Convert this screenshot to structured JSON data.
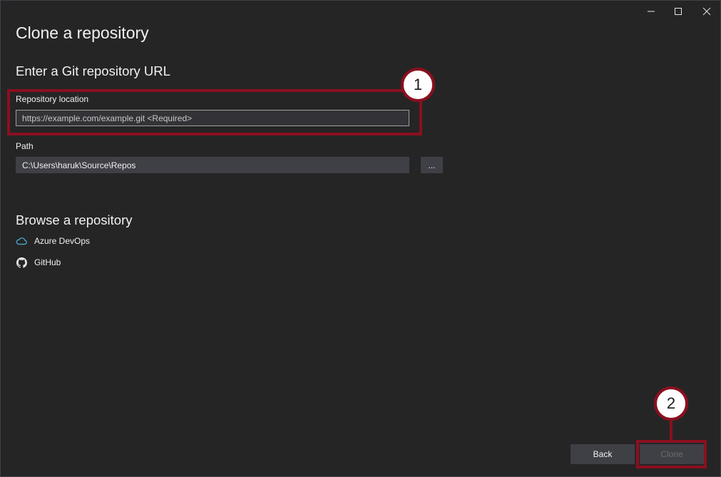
{
  "window": {
    "title": "Clone a repository"
  },
  "url_section": {
    "heading": "Enter a Git repository URL",
    "repo_label": "Repository location",
    "repo_placeholder": "https://example.com/example.git <Required>",
    "repo_value": "",
    "path_label": "Path",
    "path_value": "C:\\Users\\haruk\\Source\\Repos",
    "browse_button_label": "..."
  },
  "browse_section": {
    "heading": "Browse a repository",
    "items": [
      {
        "label": "Azure DevOps",
        "icon": "cloud-icon"
      },
      {
        "label": "GitHub",
        "icon": "github-icon"
      }
    ]
  },
  "footer": {
    "back_label": "Back",
    "clone_label": "Clone",
    "clone_enabled": false
  },
  "annotations": {
    "callout_1": "1",
    "callout_2": "2",
    "color": "#8b0f1f"
  },
  "colors": {
    "background": "#252526",
    "control": "#3f3f46",
    "azure_icon": "#4fb3d9"
  }
}
